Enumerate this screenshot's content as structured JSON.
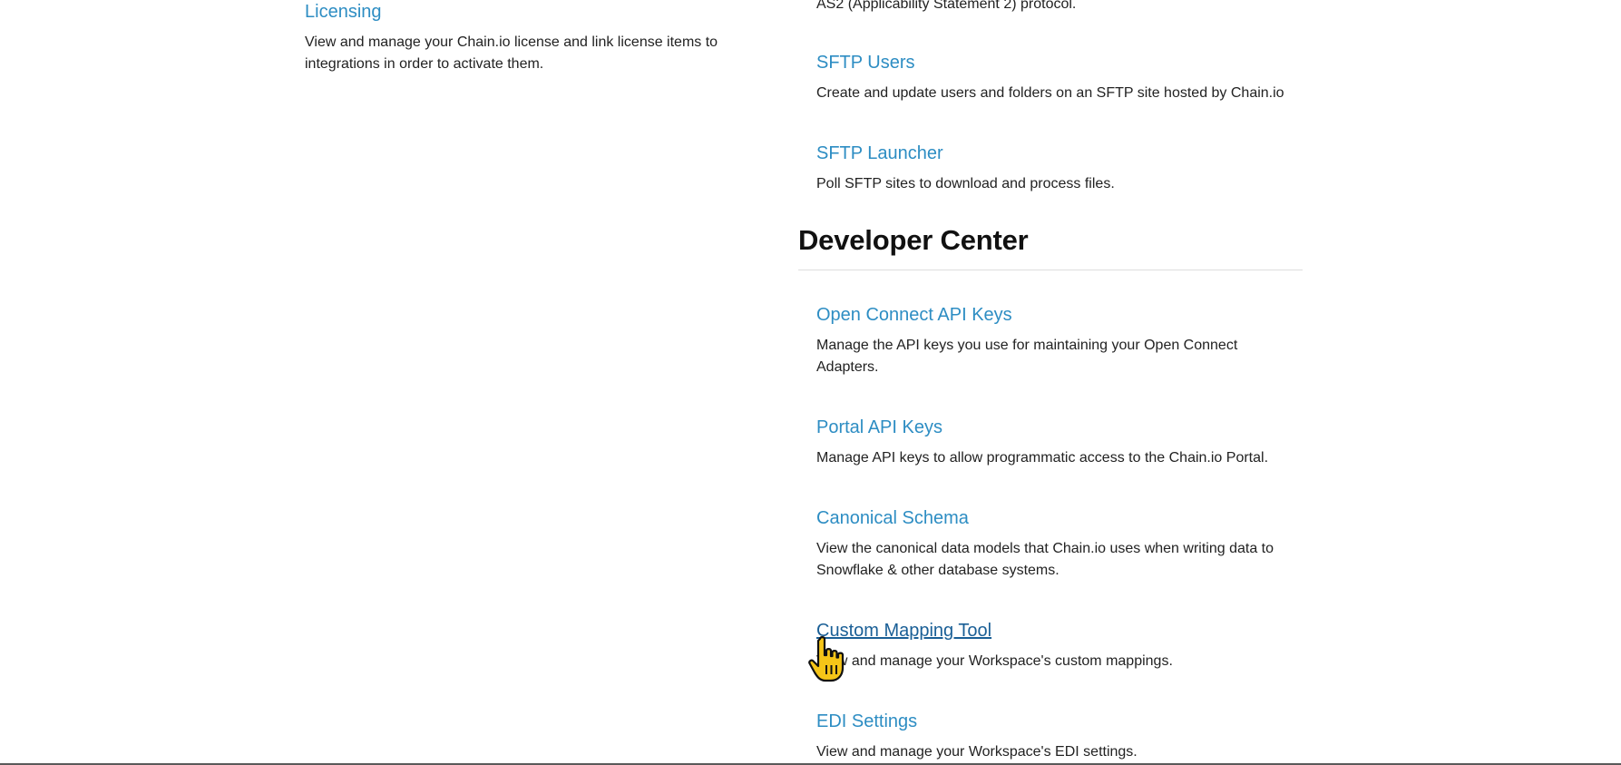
{
  "left_column": {
    "licensing": {
      "title": "Licensing",
      "description": "View and manage your Chain.io license and link license items to integrations in order to activate them."
    }
  },
  "right_column": {
    "clipped_text": "AS2 (Applicability Statement 2) protocol.",
    "sftp_users": {
      "title": "SFTP Users",
      "description": "Create and update users and folders on an SFTP site hosted by Chain.io"
    },
    "sftp_launcher": {
      "title": "SFTP Launcher",
      "description": "Poll SFTP sites to download and process files."
    },
    "developer_center": {
      "heading": "Developer Center",
      "items": [
        {
          "title": "Open Connect API Keys",
          "description": "Manage the API keys you use for maintaining your Open Connect Adapters."
        },
        {
          "title": "Portal API Keys",
          "description": "Manage API keys to allow programmatic access to the Chain.io Portal."
        },
        {
          "title": "Canonical Schema",
          "description": "View the canonical data models that Chain.io uses when writing data to Snowflake & other database systems."
        },
        {
          "title": "Custom Mapping Tool",
          "description": "View and manage your Workspace's custom mappings."
        },
        {
          "title": "EDI Settings",
          "description": "View and manage your Workspace's EDI settings."
        }
      ]
    }
  },
  "colors": {
    "link": "#2d8dc3",
    "link_hover": "#1a5f96",
    "text": "#222222",
    "heading": "#111111",
    "cursor_fill": "#f5c518"
  },
  "icons": {
    "cursor": "hand-pointer-icon"
  }
}
